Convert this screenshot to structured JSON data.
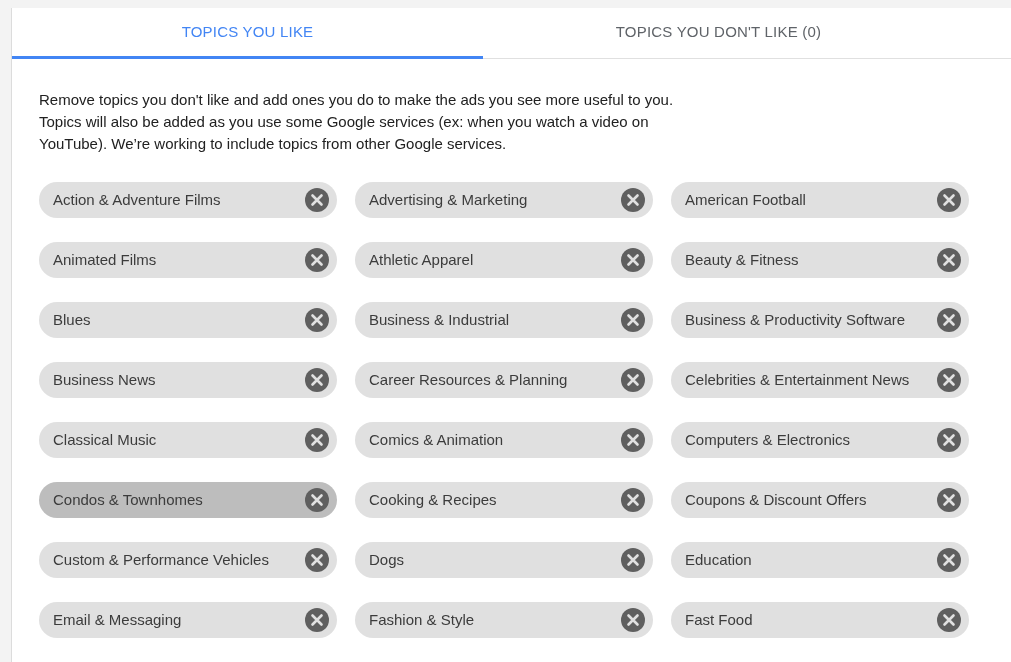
{
  "tabs": [
    {
      "label": "TOPICS YOU LIKE",
      "selected": true
    },
    {
      "label": "TOPICS YOU DON'T LIKE (0)",
      "selected": false
    }
  ],
  "description": "Remove topics you don't like and add ones you do to make the ads you see more useful to you. Topics will also be added as you use some Google services (ex: when you watch a video on YouTube). We’re working to include topics from other Google services.",
  "topics": [
    {
      "label": "Action & Adventure Films",
      "highlighted": false
    },
    {
      "label": "Advertising & Marketing",
      "highlighted": false
    },
    {
      "label": "American Football",
      "highlighted": false
    },
    {
      "label": "Animated Films",
      "highlighted": false
    },
    {
      "label": "Athletic Apparel",
      "highlighted": false
    },
    {
      "label": "Beauty & Fitness",
      "highlighted": false
    },
    {
      "label": "Blues",
      "highlighted": false
    },
    {
      "label": "Business & Industrial",
      "highlighted": false
    },
    {
      "label": "Business & Productivity Software",
      "highlighted": false
    },
    {
      "label": "Business News",
      "highlighted": false
    },
    {
      "label": "Career Resources & Planning",
      "highlighted": false
    },
    {
      "label": "Celebrities & Entertainment News",
      "highlighted": false
    },
    {
      "label": "Classical Music",
      "highlighted": false
    },
    {
      "label": "Comics & Animation",
      "highlighted": false
    },
    {
      "label": "Computers & Electronics",
      "highlighted": false
    },
    {
      "label": "Condos & Townhomes",
      "highlighted": true
    },
    {
      "label": "Cooking & Recipes",
      "highlighted": false
    },
    {
      "label": "Coupons & Discount Offers",
      "highlighted": false
    },
    {
      "label": "Custom & Performance Vehicles",
      "highlighted": false
    },
    {
      "label": "Dogs",
      "highlighted": false
    },
    {
      "label": "Education",
      "highlighted": false
    },
    {
      "label": "Email & Messaging",
      "highlighted": false
    },
    {
      "label": "Fashion & Style",
      "highlighted": false
    },
    {
      "label": "Fast Food",
      "highlighted": false
    }
  ]
}
